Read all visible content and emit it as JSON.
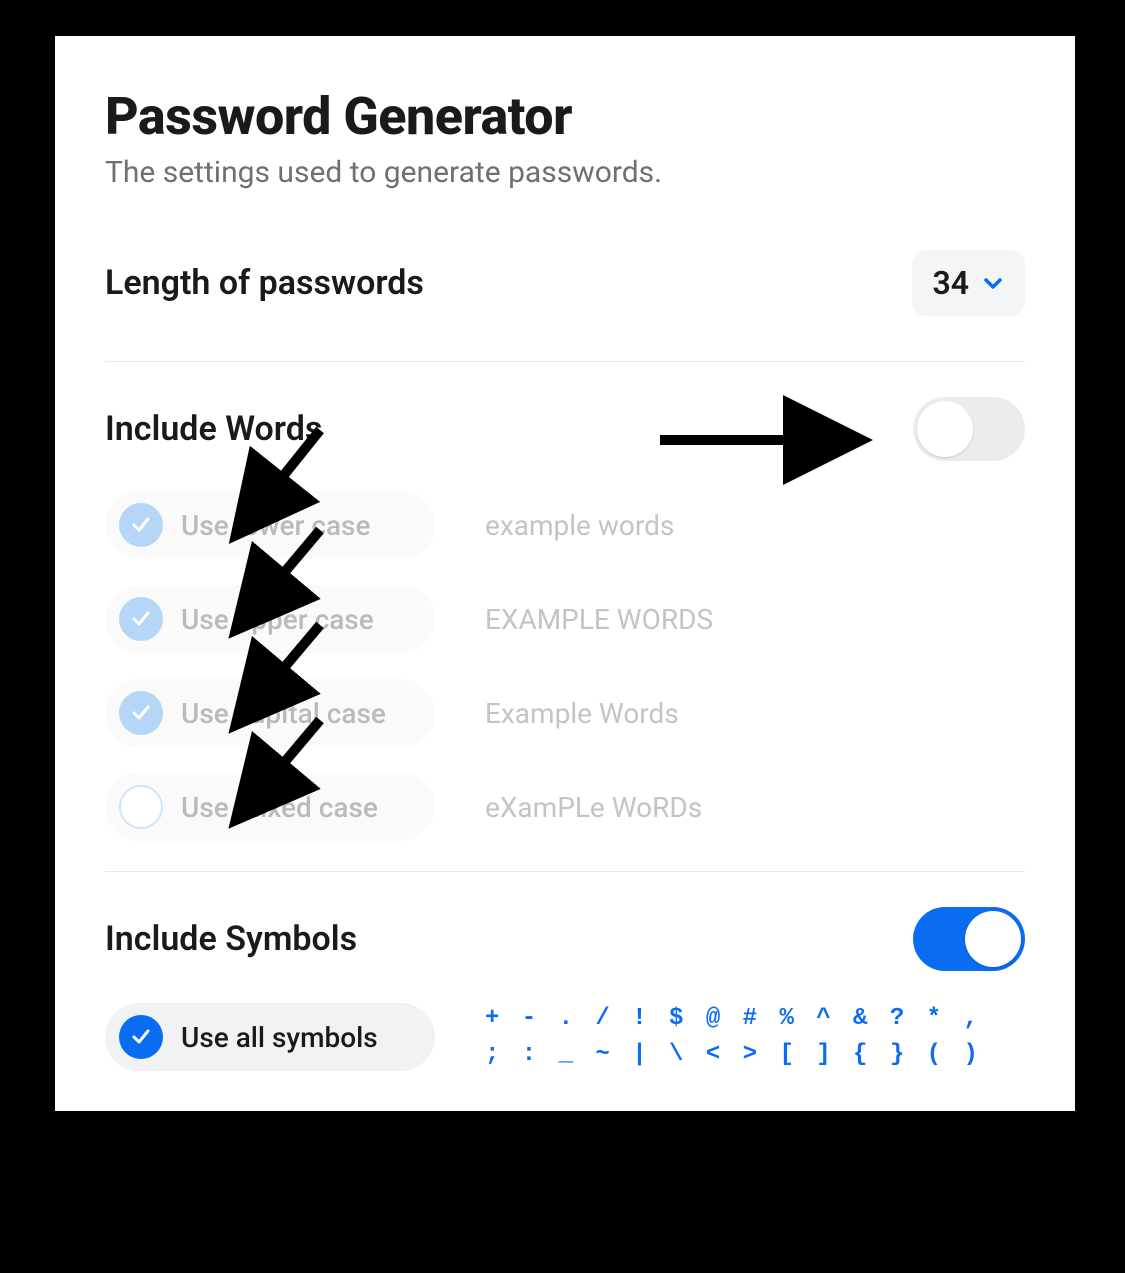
{
  "title": "Password Generator",
  "subtitle": "The settings used to generate passwords.",
  "length": {
    "label": "Length of passwords",
    "value": "34"
  },
  "include_words": {
    "label": "Include Words",
    "enabled": false,
    "options": [
      {
        "label": "Use lower case",
        "example": "example words",
        "checked": true
      },
      {
        "label": "Use upper case",
        "example": "EXAMPLE WORDS",
        "checked": true
      },
      {
        "label": "Use capital case",
        "example": "Example Words",
        "checked": true
      },
      {
        "label": "Use mixed case",
        "example": "eXamPLe WoRDs",
        "checked": false
      }
    ]
  },
  "include_symbols": {
    "label": "Include Symbols",
    "enabled": true,
    "option_label": "Use all symbols",
    "symbols_line1": "+ - . / ! $ @ # % ^ & ? * ,",
    "symbols_line2": "; : _ ~ | \\ < > [ ] { } ( )"
  },
  "colors": {
    "accent": "#0a6cf1"
  }
}
